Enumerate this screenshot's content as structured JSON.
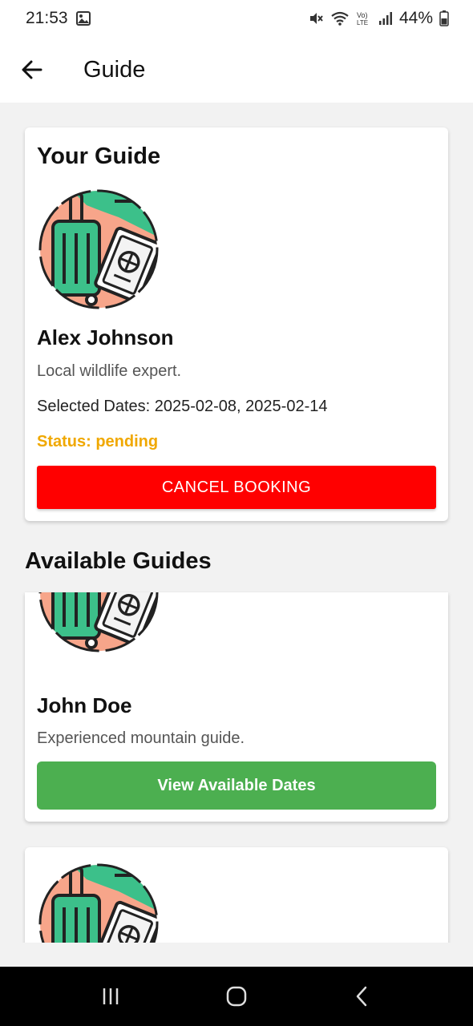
{
  "status_bar": {
    "time": "21:53",
    "battery": "44%",
    "icons": [
      "image-icon",
      "mute-icon",
      "wifi-icon",
      "volte-icon",
      "signal-icon",
      "battery-icon"
    ]
  },
  "header": {
    "title": "Guide",
    "back_icon": "arrow-left-icon"
  },
  "your_guide": {
    "title": "Your Guide",
    "name": "Alex Johnson",
    "description": "Local wildlife expert.",
    "dates": "Selected Dates: 2025-02-08, 2025-02-14",
    "status": "Status: pending",
    "cancel_label": "CANCEL BOOKING"
  },
  "available": {
    "title": "Available Guides",
    "guides": [
      {
        "name": "John Doe",
        "description": "Experienced mountain guide.",
        "button_label": "View Available Dates"
      }
    ]
  },
  "colors": {
    "cancel": "#ff0000",
    "view": "#4caf50",
    "status": "#f0a800",
    "avatar_bg": "#f7a58a",
    "avatar_green": "#3cc08a"
  },
  "nav": [
    "recent-apps-icon",
    "home-icon",
    "back-icon"
  ]
}
